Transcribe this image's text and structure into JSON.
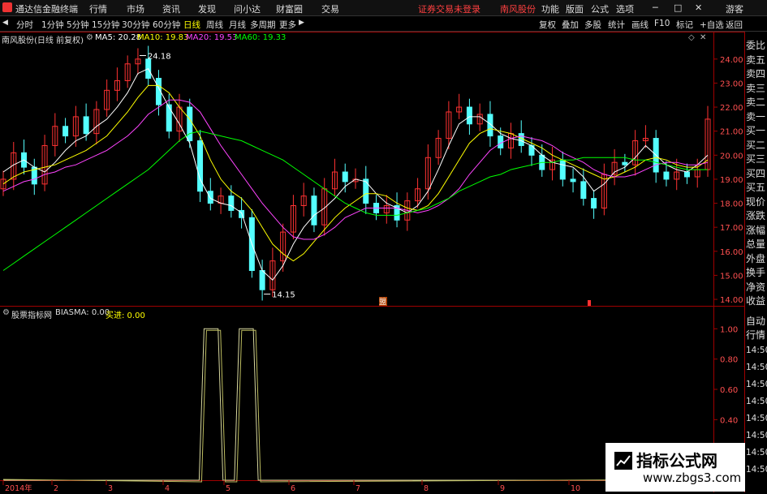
{
  "app": {
    "title": "通达信金融终端",
    "colors": {
      "up": "#ff3232",
      "down": "#54ffff",
      "ma5": "#ffffff",
      "ma10": "#ffff00",
      "ma20": "#ff44ff",
      "ma60": "#00ff00"
    }
  },
  "menu": {
    "items": [
      "行情",
      "市场",
      "资讯",
      "发现",
      "问小达",
      "财富圈",
      "交易"
    ],
    "notice": "证券交易未登录",
    "stock": "南风股份",
    "right": [
      "功能",
      "版面",
      "公式",
      "选项"
    ],
    "user": "游客",
    "window_controls": [
      "─",
      "□",
      "✕"
    ]
  },
  "periods": [
    "分时",
    "1分钟",
    "5分钟",
    "15分钟",
    "30分钟",
    "60分钟",
    "日线",
    "周线",
    "月线",
    "多周期",
    "更多"
  ],
  "active_period": "日线",
  "toolbar_right": [
    "复权",
    "叠加",
    "多股",
    "统计",
    "画线",
    "F10",
    "标记",
    "+自选",
    "返回"
  ],
  "main_chart": {
    "title": "南风股份(日线 前复权)",
    "ma5": "MA5: 20.28",
    "ma10": "MA10: 19.83",
    "ma20": "MA20: 19.53",
    "ma60": "MA60: 19.33",
    "high_label": "24.18",
    "low_label": "14.15",
    "y_ticks": [
      "24.00",
      "23.00",
      "22.00",
      "21.00",
      "20.00",
      "19.00",
      "18.00",
      "17.00",
      "16.00",
      "15.00",
      "14.00"
    ],
    "marker": "盟"
  },
  "sub_chart": {
    "title": "股票指标网",
    "biasma": "BIASMA: 0.00",
    "buy": "买进: 0.00",
    "y_ticks": [
      "1.00",
      "0.80",
      "0.60",
      "0.40",
      "0.20"
    ]
  },
  "x_axis": [
    "2014年",
    "2",
    "3",
    "4",
    "5",
    "6",
    "7",
    "8",
    "9",
    "10",
    "11"
  ],
  "side_panel": [
    "委比",
    "卖五",
    "卖四",
    "卖三",
    "卖二",
    "卖一",
    "买一",
    "买二",
    "买三",
    "买四",
    "买五",
    "现价",
    "涨跌",
    "涨幅",
    "总量",
    "外盘",
    "换手",
    "净资",
    "收益",
    "自动",
    "行情",
    "14:50",
    "14:50",
    "14:50",
    "14:50",
    "14:50",
    "14:50",
    "14:50",
    "14:50"
  ],
  "watermark": {
    "line1": "指标公式网",
    "line2": "www.zbgs3.com"
  },
  "chart_data": {
    "type": "line",
    "price_range": [
      13.9,
      24.5
    ],
    "ma_series": [
      {
        "name": "MA5",
        "values": [
          19.3,
          19.6,
          19.8,
          19.5,
          19.3,
          19.7,
          20.2,
          20.6,
          20.8,
          21.2,
          21.5,
          22.0,
          22.6,
          23.4,
          23.6,
          22.8,
          22.0,
          21.3,
          20.5,
          19.0,
          18.2,
          18.0,
          17.9,
          17.6,
          16.3,
          15.2,
          14.8,
          15.4,
          16.3,
          17.0,
          17.5,
          17.8,
          18.2,
          18.7,
          19.0,
          18.9,
          18.4,
          18.0,
          17.8,
          17.6,
          17.9,
          18.5,
          19.4,
          20.4,
          21.3,
          21.6,
          21.6,
          21.3,
          20.9,
          20.7,
          20.6,
          20.4,
          20.0,
          19.7,
          19.6,
          19.5,
          19.1,
          18.5,
          18.8,
          19.3,
          19.5,
          19.9,
          20.4,
          20.0,
          19.6,
          19.4,
          19.3,
          19.6,
          20.0
        ]
      },
      {
        "name": "MA10",
        "values": [
          18.8,
          19.1,
          19.3,
          19.4,
          19.5,
          19.6,
          19.8,
          20.0,
          20.2,
          20.5,
          20.8,
          21.3,
          21.8,
          22.4,
          22.9,
          22.9,
          22.6,
          22.0,
          21.5,
          20.8,
          19.8,
          19.0,
          18.5,
          18.2,
          17.7,
          17.0,
          16.3,
          15.9,
          15.6,
          15.9,
          16.4,
          16.9,
          17.4,
          17.8,
          18.1,
          18.4,
          18.4,
          18.3,
          18.0,
          17.8,
          17.7,
          17.9,
          18.4,
          19.1,
          19.8,
          20.5,
          20.9,
          21.1,
          21.0,
          20.9,
          20.7,
          20.5,
          20.3,
          20.0,
          19.8,
          19.6,
          19.4,
          19.2,
          19.0,
          19.1,
          19.3,
          19.5,
          19.8,
          19.9,
          19.8,
          19.6,
          19.5,
          19.5,
          19.8
        ]
      },
      {
        "name": "MA20",
        "values": [
          18.5,
          18.7,
          18.9,
          19.0,
          19.2,
          19.3,
          19.5,
          19.6,
          19.8,
          20.0,
          20.2,
          20.5,
          20.8,
          21.2,
          21.7,
          22.0,
          22.3,
          22.3,
          22.2,
          21.8,
          21.1,
          20.4,
          19.8,
          19.2,
          18.6,
          18.0,
          17.5,
          17.0,
          16.6,
          16.5,
          16.5,
          16.7,
          17.0,
          17.4,
          17.6,
          17.8,
          17.8,
          17.8,
          17.8,
          17.7,
          17.6,
          17.7,
          17.9,
          18.2,
          18.6,
          19.2,
          19.7,
          20.2,
          20.5,
          20.7,
          20.8,
          20.7,
          20.6,
          20.4,
          20.1,
          19.9,
          19.7,
          19.4,
          19.2,
          19.1,
          19.1,
          19.2,
          19.4,
          19.6,
          19.7,
          19.7,
          19.6,
          19.6,
          19.7
        ]
      },
      {
        "name": "MA60",
        "values": [
          15.2,
          15.5,
          15.8,
          16.1,
          16.4,
          16.7,
          17.0,
          17.3,
          17.6,
          17.9,
          18.2,
          18.5,
          18.8,
          19.1,
          19.4,
          19.8,
          20.2,
          20.6,
          20.9,
          21.0,
          20.9,
          20.8,
          20.7,
          20.6,
          20.4,
          20.2,
          20.0,
          19.8,
          19.5,
          19.2,
          18.9,
          18.6,
          18.3,
          18.0,
          17.8,
          17.6,
          17.5,
          17.5,
          17.5,
          17.6,
          17.7,
          17.8,
          18.0,
          18.2,
          18.5,
          18.7,
          18.9,
          19.1,
          19.2,
          19.4,
          19.5,
          19.6,
          19.7,
          19.7,
          19.8,
          19.8,
          19.9,
          19.9,
          19.9,
          19.9,
          19.9,
          19.8,
          19.8,
          19.7,
          19.6,
          19.5,
          19.4,
          19.4,
          19.4
        ]
      }
    ],
    "candles_close": [
      19.0,
      20.1,
      19.5,
      18.8,
      20.4,
      21.2,
      20.8,
      21.6,
      20.9,
      21.9,
      22.7,
      23.1,
      23.8,
      24.0,
      23.2,
      22.1,
      21.0,
      22.0,
      20.6,
      18.5,
      18.0,
      18.3,
      17.7,
      17.4,
      15.2,
      14.4,
      15.6,
      16.8,
      17.9,
      18.3,
      17.1,
      18.6,
      19.3,
      18.9,
      19.0,
      18.0,
      17.6,
      17.9,
      17.3,
      18.1,
      18.6,
      19.9,
      20.7,
      21.8,
      22.0,
      21.3,
      21.7,
      20.8,
      20.3,
      20.9,
      20.4,
      20.0,
      19.4,
      19.8,
      19.0,
      18.9,
      18.2,
      17.8,
      19.2,
      19.7,
      19.6,
      20.6,
      20.7,
      19.3,
      19.0,
      19.3,
      19.1,
      19.4,
      21.5
    ],
    "biasma": {
      "pulses": [
        [
          0.285,
          0.305
        ],
        [
          0.335,
          0.355
        ]
      ],
      "value_high": 1.0,
      "value_low": 0.0
    },
    "sub_range": [
      0,
      1.05
    ]
  }
}
